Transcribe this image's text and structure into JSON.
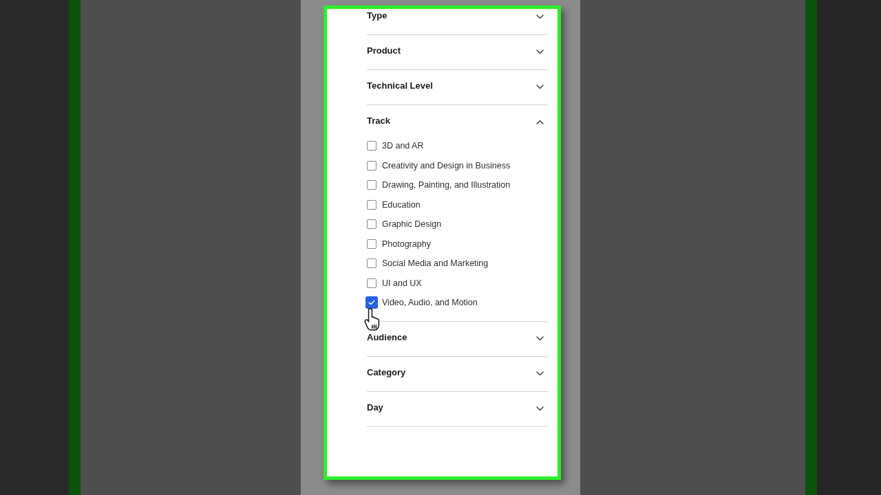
{
  "sections": [
    {
      "title": "Type",
      "expanded": false
    },
    {
      "title": "Product",
      "expanded": false
    },
    {
      "title": "Technical Level",
      "expanded": false
    },
    {
      "title": "Track",
      "expanded": true,
      "options": [
        {
          "label": "3D and AR",
          "checked": false
        },
        {
          "label": "Creativity and Design in Business",
          "checked": false
        },
        {
          "label": "Drawing, Painting, and Illustration",
          "checked": false
        },
        {
          "label": "Education",
          "checked": false
        },
        {
          "label": "Graphic Design",
          "checked": false
        },
        {
          "label": "Photography",
          "checked": false
        },
        {
          "label": "Social Media and Marketing",
          "checked": false
        },
        {
          "label": "UI and UX",
          "checked": false
        },
        {
          "label": "Video, Audio, and Motion",
          "checked": true
        }
      ]
    },
    {
      "title": "Audience",
      "expanded": false
    },
    {
      "title": "Category",
      "expanded": false
    },
    {
      "title": "Day",
      "expanded": false
    }
  ]
}
